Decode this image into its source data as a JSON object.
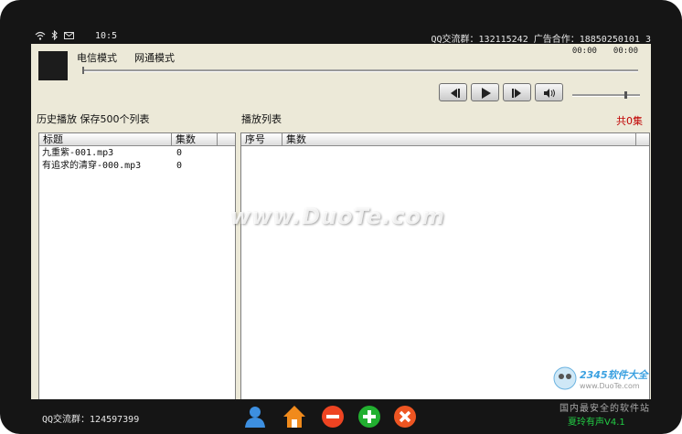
{
  "status_bar": {
    "time": "10:5",
    "qq_group_ad": "QQ交流群：132115242 广告合作：18850250101 3"
  },
  "player": {
    "mode_telecom": "电信模式",
    "mode_netcom": "网通模式",
    "time_current": "00:00",
    "time_total": "00:00",
    "progress": 0,
    "volume": 0.8
  },
  "history": {
    "title": "历史播放 保存500个列表",
    "columns": [
      "标题",
      "集数"
    ],
    "rows": [
      {
        "title": "九重紫-001.mp3",
        "episodes": "0"
      },
      {
        "title": "有追求的清穿-000.mp3",
        "episodes": "0"
      }
    ]
  },
  "playlist": {
    "title": "播放列表",
    "count": "共0集",
    "columns": [
      "序号",
      "集数"
    ]
  },
  "watermark": "www.DuoTe.com",
  "bottom_bar": {
    "qq_group": "QQ交流群：124597399",
    "version": "夏玲有声V4.1"
  },
  "brand": {
    "line1": "2345软件大全",
    "line2": "www.DuoTe.com",
    "line3": "国内最安全的软件站"
  },
  "icons": [
    "wifi-icon",
    "bluetooth-icon",
    "mail-icon",
    "previous-icon",
    "play-icon",
    "next-icon",
    "volume-icon",
    "user-icon",
    "home-icon",
    "remove-icon",
    "add-icon",
    "close-icon"
  ],
  "colors": {
    "accent_red": "#c00000",
    "version_green": "#22cc44",
    "screen_bg": "#ece9d8"
  }
}
